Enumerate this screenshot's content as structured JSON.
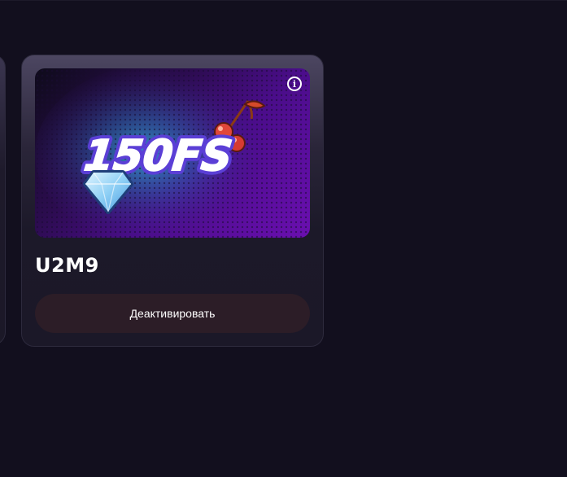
{
  "promo_card": {
    "banner_text": "150FS",
    "code": "U2M9",
    "deactivate_label": "Деактивировать",
    "info_symbol": "i"
  },
  "icons": [
    "info-icon",
    "diamond-icon",
    "cherries-icon"
  ],
  "colors": {
    "page_background": "#120f1e",
    "card_background": "#1b1828",
    "button_background": "#2c1d27",
    "banner_purple": "#6a0fb0",
    "banner_text_fill": "#ffffff",
    "banner_text_outline": "#5b3fd6"
  }
}
